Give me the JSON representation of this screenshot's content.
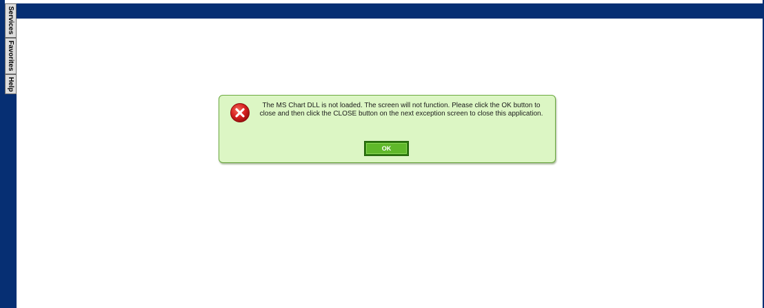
{
  "sidebar": {
    "tabs": [
      {
        "label": "Services"
      },
      {
        "label": "Favorites"
      },
      {
        "label": "Help"
      }
    ]
  },
  "dialog": {
    "icon": "error-icon",
    "message": "The MS Chart DLL is not loaded. The screen will not function. Please click the OK button to close and then click the CLOSE button on the next exception screen to close this application.",
    "ok_label": "OK"
  },
  "colors": {
    "frame": "#062f73",
    "dialog_background": "#dcf6c4",
    "dialog_border": "#6aa83f",
    "ok_button": "#5fb82a",
    "error_red": "#d62020"
  }
}
